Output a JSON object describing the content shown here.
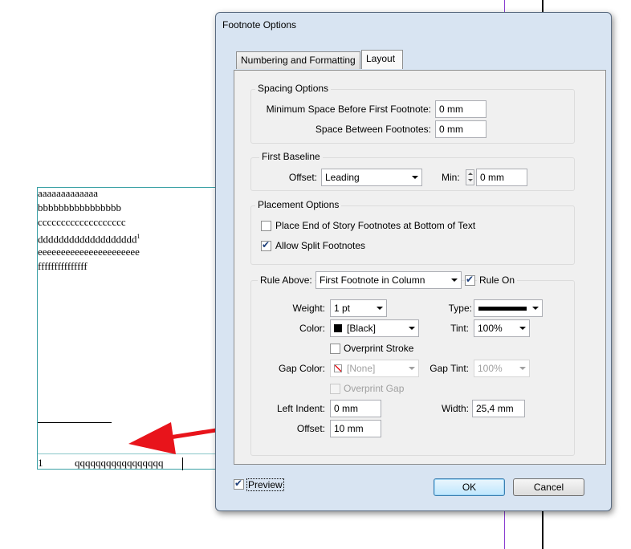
{
  "document": {
    "lines": [
      "aaaaaaaaaaaaa",
      "bbbbbbbbbbbbbbbb",
      "ccccccccccccccccccc",
      "ddddddddddddddddddd",
      "eeeeeeeeeeeeeeeeeeeeee",
      "fffffffffffffff"
    ],
    "superscript": "1",
    "footnote_number": "1",
    "footnote_text": "qqqqqqqqqqqqqqqqq"
  },
  "dialog": {
    "title": "Footnote Options",
    "tabs": [
      {
        "label": "Numbering and Formatting",
        "active": false
      },
      {
        "label": "Layout",
        "active": true
      }
    ],
    "spacing": {
      "legend": "Spacing Options",
      "min_space_label": "Minimum Space Before First Footnote:",
      "min_space_value": "0 mm",
      "between_label": "Space Between Footnotes:",
      "between_value": "0 mm"
    },
    "baseline": {
      "legend": "First Baseline",
      "offset_label": "Offset:",
      "offset_value": "Leading",
      "min_label": "Min:",
      "min_value": "0 mm"
    },
    "placement": {
      "legend": "Placement Options",
      "end_of_story_label": "Place End of Story Footnotes at Bottom of Text",
      "end_of_story_checked": false,
      "split_label": "Allow Split Footnotes",
      "split_checked": true
    },
    "rule": {
      "rule_above_label": "Rule Above:",
      "rule_above_value": "First Footnote in Column",
      "rule_on_label": "Rule On",
      "rule_on_checked": true,
      "weight_label": "Weight:",
      "weight_value": "1 pt",
      "type_label": "Type:",
      "color_label": "Color:",
      "color_value": "[Black]",
      "tint_label": "Tint:",
      "tint_value": "100%",
      "overprint_stroke_label": "Overprint Stroke",
      "gap_color_label": "Gap Color:",
      "gap_color_value": "[None]",
      "gap_tint_label": "Gap Tint:",
      "gap_tint_value": "100%",
      "overprint_gap_label": "Overprint Gap",
      "left_indent_label": "Left Indent:",
      "left_indent_value": "0 mm",
      "width_label": "Width:",
      "width_value": "25,4 mm",
      "offset_label": "Offset:",
      "offset_value": "10 mm"
    },
    "preview_label": "Preview",
    "preview_checked": true,
    "ok_label": "OK",
    "cancel_label": "Cancel"
  },
  "colors": {
    "arrow": "#e8141b",
    "frame": "#3aa0a5",
    "guide": "#8a3fd1"
  }
}
